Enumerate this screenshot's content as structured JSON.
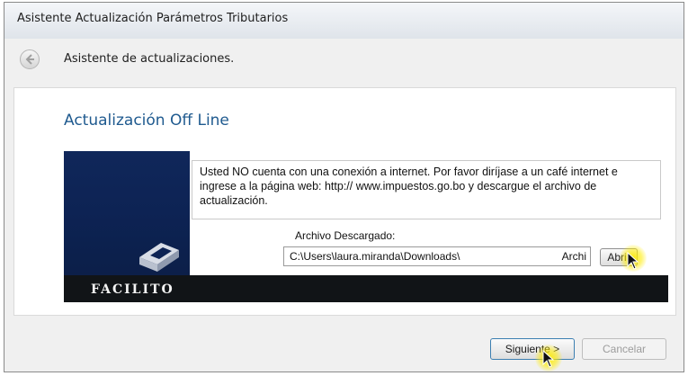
{
  "window": {
    "title": "Asistente Actualización Parámetros Tributarios"
  },
  "nav": {
    "back_icon": "back-arrow-icon",
    "title": "Asistente de actualizaciones."
  },
  "content": {
    "section_title": "Actualización Off Line",
    "message": "Usted NO cuenta con una conexión a internet.  Por favor diríjase a un café internet e ingrese a  la página web: http:// www.impuestos.go.bo y descargue el archivo de actualización.",
    "file_label": "Archivo Descargado:",
    "file_value": "C:\\Users\\laura.miranda\\Downloads\\",
    "file_value_extra": "Archi",
    "open_button": "Abrir",
    "logo_text": "FACILITO"
  },
  "footer": {
    "next_button": "Siguiente >",
    "cancel_button": "Cancelar"
  },
  "colors": {
    "section_title": "#1f5a8f",
    "banner_blue": "#0d2354",
    "banner_black": "#111417",
    "highlight": "#ffec00"
  }
}
